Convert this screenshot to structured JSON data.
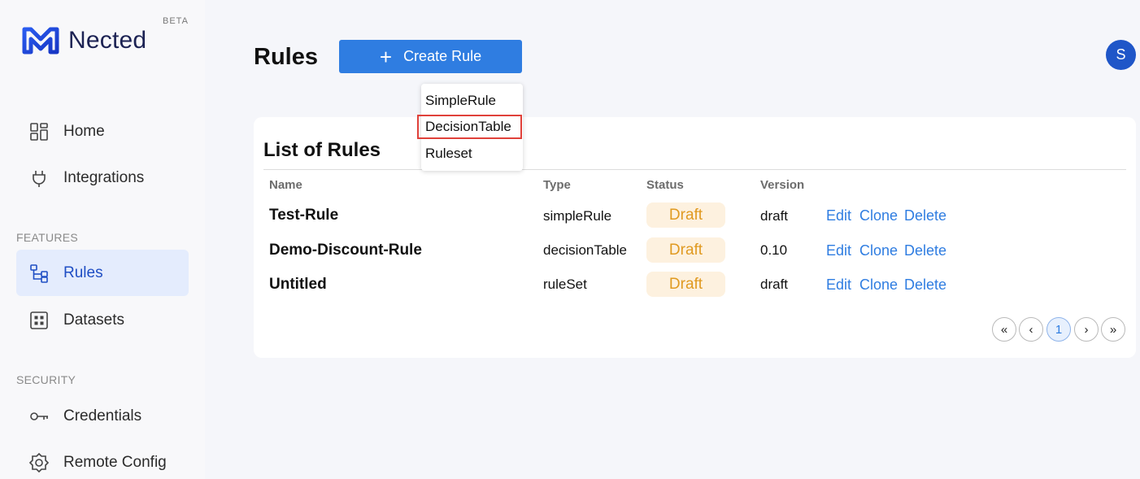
{
  "brand": {
    "name": "Nected",
    "badge": "BETA"
  },
  "sidebar": {
    "items_top": [
      {
        "label": "Home",
        "icon": "dashboard-icon"
      },
      {
        "label": "Integrations",
        "icon": "plug-icon"
      }
    ],
    "features_label": "FEATURES",
    "features": [
      {
        "label": "Rules",
        "icon": "hierarchy-icon",
        "active": true
      },
      {
        "label": "Datasets",
        "icon": "grid-icon"
      }
    ],
    "security_label": "SECURITY",
    "security": [
      {
        "label": "Credentials",
        "icon": "key-icon"
      },
      {
        "label": "Remote Config",
        "icon": "gear-icon"
      }
    ]
  },
  "header": {
    "title": "Rules",
    "create_button": "Create Rule",
    "avatar_initial": "S"
  },
  "dropdown": {
    "items": [
      "SimpleRule",
      "DecisionTable",
      "Ruleset"
    ],
    "highlighted": "DecisionTable"
  },
  "rules": {
    "title": "List of Rules",
    "columns": [
      "Name",
      "Type",
      "Status",
      "Version"
    ],
    "rows": [
      {
        "name": "Test-Rule",
        "type": "simpleRule",
        "status": "Draft",
        "version": "draft"
      },
      {
        "name": "Demo-Discount-Rule",
        "type": "decisionTable",
        "status": "Draft",
        "version": "0.10"
      },
      {
        "name": "Untitled",
        "type": "ruleSet",
        "status": "Draft",
        "version": "draft"
      }
    ],
    "actions": [
      "Edit",
      "Clone",
      "Delete"
    ]
  },
  "pagination": {
    "first": "«",
    "prev": "‹",
    "current": "1",
    "next": "›",
    "last": "»"
  },
  "colors": {
    "primary": "#2f7de1",
    "draft_bg": "#fdf1df",
    "draft_text": "#e09a21",
    "active_nav_bg": "#e4ecfd"
  }
}
